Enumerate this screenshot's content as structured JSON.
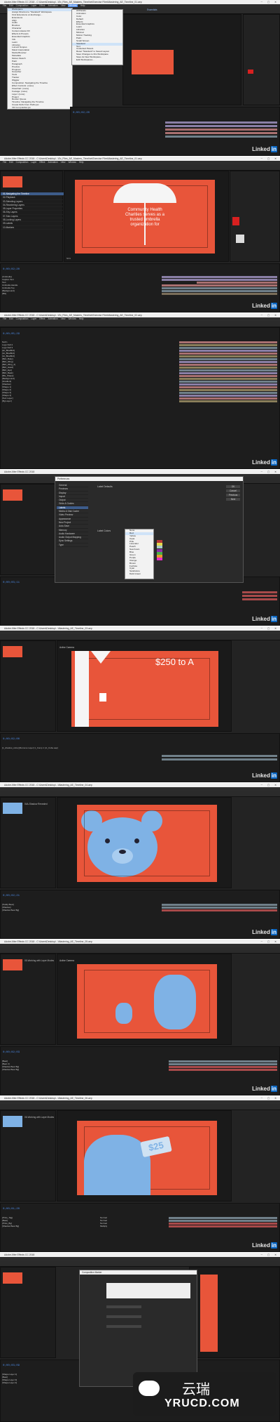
{
  "app_title": "Adobe After Effects CC 2018",
  "frames": [
    {
      "title": "Adobe After Effects CC 2018 - C:\\Users\\Desktop\\...\\Ex_Files_AE_Masters_Timeline\\Exercise Files\\Mastering_AE_Timeline_01.aep",
      "menus": [
        "File",
        "Edit",
        "Composition",
        "Layer",
        "Effect",
        "Animation",
        "View",
        "Window",
        "Help"
      ],
      "workspace": "Essentials",
      "window_menu": [
        "Workspace",
        "Assign Shortcut to \"Standard\" Workspace",
        "Find Extensions on Exchange...",
        "Extensions",
        "Align",
        "Audio",
        "Brushes",
        "Character",
        "Content-Aware Fill",
        "Effects & Presets",
        "Essential Graphics",
        "Info",
        "Learn",
        "Libraries",
        "Lumetri Scopes",
        "Mask Interpolation",
        "Media Browser",
        "Metadata",
        "Motion Sketch",
        "Paint",
        "Paragraph",
        "Preview",
        "Progress",
        "Smoother",
        "Tools",
        "Tracker",
        "Wiggler",
        "Composition: Navigating the Timeline",
        "Effect Controls: (none)",
        "Flowchart: (none)",
        "Footage: (none)",
        "Layer: (none)",
        "Project",
        "Render Queue",
        "Timeline: Navigating the Timeline",
        "Create Nulls From Paths.jsx",
        "VR Comp Editor.jsx"
      ],
      "workspace_menu": [
        "All Panels",
        "Animation",
        "Color",
        "Default",
        "Effects",
        "Essential Graphics",
        "Learn",
        "Libraries",
        "Minimal",
        "Motion Tracking",
        "Paint",
        "Small Screen",
        "Standard",
        "Text",
        "Undocked Panels",
        "Reset \"Standard\" to Saved Layout",
        "Save Changes to this Workspace",
        "Save As New Workspace...",
        "Edit Workspaces..."
      ],
      "timecode": "0;00;02;20"
    },
    {
      "title": "Adobe After Effects CC 2018 - C:\\Users\\Desktop\\...\\Ex_Files_AE_Masters_Timeline\\Exercise Files\\Mastering_AE_Timeline_01.aep",
      "project_items": [
        "01-Navigating the Timeline",
        "02-Playback",
        "03-Selecting Layers",
        "04-Reordering Layers",
        "05-Layer Properties",
        "06-Shy Layers",
        "07-Solo Layers",
        "08-Locking Layers",
        "09-Labels",
        "10-Markers"
      ],
      "comp_text": [
        "Community Health",
        "Charities serves as a",
        "trusted umbrella",
        "organization for"
      ],
      "zoom": "50%",
      "timecode": "0;00;02;20",
      "layers": [
        "[Umbrella]",
        "Caption Text",
        "Text",
        "Umbrella Handle",
        "Umbrella Top",
        "[Background]",
        "[BG]"
      ]
    },
    {
      "title": "Adobe After Effects CC 2018 - C:\\Users\\Desktop\\...\\Ex_Files_AE_Masters_Timeline\\Exercise Files\\Mastering_AE_Timeline_02.aep",
      "timecode": "0;00;05;29",
      "layers": [
        "Null 1",
        "Logo Null 2",
        "Logo Null 3",
        "[lot_BlueBird]",
        "[txt_BlueBird]",
        "[txt_BlueBird]",
        "[Bird_Body]",
        "[Bird_Wing]",
        "[Bird_Wing_2]",
        "[Bird_Head]",
        "[Bird_Eye]",
        "[Bird_Beak]",
        "[BG_Shape]",
        "[Background]",
        "[Gradient]",
        "[Shadow]",
        "[Shape 1]",
        "[Shape 2]",
        "[Shape 3]",
        "[Shape 4]",
        "[Text Layer]",
        "[Bg Layer]"
      ]
    },
    {
      "title": "Adobe After Effects CC 2018",
      "dialog_title": "Preferences",
      "pref_categories": [
        "General",
        "Previews",
        "Display",
        "Import",
        "Output",
        "Grids & Guides",
        "Labels",
        "Media & Disk Cache",
        "Video Preview",
        "Appearance",
        "New Project",
        "Auto-Save",
        "Memory",
        "Audio Hardware",
        "Audio Output Mapping",
        "Sync Settings",
        "Type"
      ],
      "label_defaults_heading": "Label Defaults",
      "label_colors_heading": "Label Colors",
      "label_dropdown": [
        "None",
        "Red",
        "Yellow",
        "Aqua",
        "Pink",
        "Lavender",
        "Peach",
        "Sea Foam",
        "Blue",
        "Green",
        "Purple",
        "Orange",
        "Brown",
        "Fuchsia",
        "Cyan",
        "Sandstone",
        "Dark Green"
      ],
      "buttons": [
        "OK",
        "Cancel",
        "Previous",
        "Next"
      ],
      "timecode": "0;00;03;11"
    },
    {
      "title": "Adobe After Effects CC 2018 - C:\\Users\\Desktop\\...\\Mastering_AE_Timeline_03.aep",
      "comp_text": "$250 to A",
      "view_label": "Active Camera",
      "timecode": "0;00;02;00",
      "timeline_layer": "[1_shadow_cube] [Remove Layer] 1_Comp 1 (ct_Cube.aep)"
    },
    {
      "title": "Adobe After Effects CC 2018 - C:\\Users\\Desktop\\...\\Mastering_AE_Timeline_04.aep",
      "comp_name": "04A-Shadow Revealed",
      "timecode": "0;00;02;21",
      "layers": [
        "[Teddy Bear]",
        "[Shadow]",
        "[Shadow Bear Bg]"
      ]
    },
    {
      "title": "Adobe After Effects CC 2018 - C:\\Users\\Desktop\\...\\Mastering_AE_Timeline_05.aep",
      "comp_name": "05-Working with Layer Modes",
      "view_label": "Active Camera",
      "timecode": "0;00;02;03",
      "layers": [
        "[Bear]",
        "[Bear 2]",
        "[Shadow Bear Bg]",
        "[Shadow Bear Bg]"
      ]
    },
    {
      "title": "Adobe After Effects CC 2018 - C:\\Users\\Desktop\\...\\Mastering_AE_Timeline_06.aep",
      "comp_name": "06-Working with Layer Modes",
      "price": "$25",
      "timecode": "0;00;01;20",
      "layers": [
        "[Price_Tag]",
        "[Bear]",
        "[Price_Bg]",
        "[Shadow Bear Bg]"
      ],
      "modes": [
        "Normal",
        "Normal",
        "Normal",
        "Multiply"
      ]
    },
    {
      "title": "Adobe After Effects CC 2018",
      "dialog_title": "Composition Marker",
      "timecode": "0;00;03;09",
      "layers": [
        "[Shape Layer 1]",
        "[Bear]",
        "[Shape Layer 3]",
        "[Shape Layer 4]"
      ],
      "dialog_buttons": [
        "OK",
        "Cancel"
      ]
    }
  ],
  "linkedin": "Linked",
  "linkedin_in": "in",
  "watermark_text": "云瑞",
  "watermark_url": "YRUCD.COM",
  "colors": {
    "accent_orange": "#e8553a",
    "ae_blue": "#4d8be8",
    "panel_dark": "#1d1d1d",
    "label_red": "#b53838",
    "label_yellow": "#e4d84c",
    "label_aqua": "#a9cbc7",
    "label_lavender": "#a9a9ca",
    "label_green": "#4ab04a",
    "label_purple": "#8e2ea8",
    "label_orange": "#e89a2a",
    "label_fuchsia": "#e52ec3",
    "bear_blue": "#7fb2e5"
  }
}
